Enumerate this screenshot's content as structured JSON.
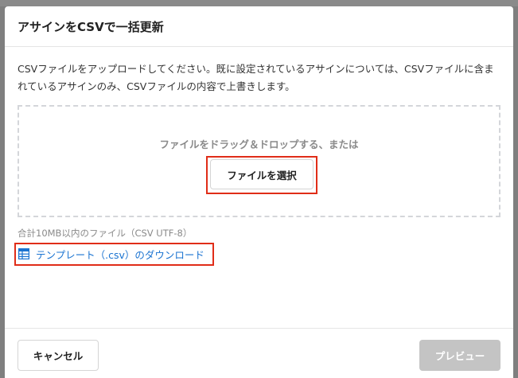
{
  "dialog": {
    "title": "アサインをCSVで一括更新",
    "description": "CSVファイルをアップロードしてください。既に設定されているアサインについては、CSVファイルに含まれているアサインのみ、CSVファイルの内容で上書きします。"
  },
  "dropzone": {
    "hint": "ファイルをドラッグ＆ドロップする、または",
    "select_label": "ファイルを選択"
  },
  "limit_note": "合計10MB以内のファイル（CSV UTF-8）",
  "template_link": {
    "label": "テンプレート（.csv）のダウンロード",
    "icon": "spreadsheet-icon"
  },
  "footer": {
    "cancel_label": "キャンセル",
    "preview_label": "プレビュー"
  },
  "colors": {
    "accent": "#1a73d1",
    "highlight": "#e02d18",
    "disabled": "#c4c4c4"
  }
}
